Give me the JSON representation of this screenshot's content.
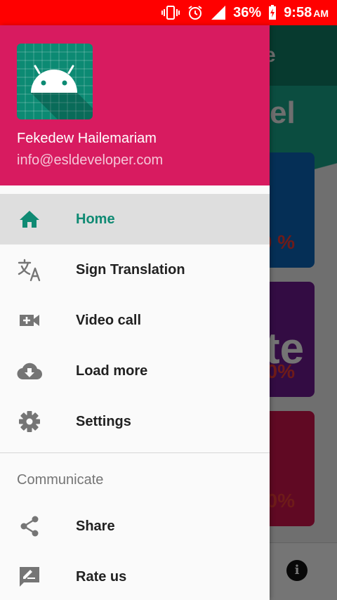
{
  "status_bar": {
    "battery": "36%",
    "time": "9:58",
    "ampm": "AM",
    "icons": [
      "vibrate-icon",
      "alarm-icon",
      "signal-icon",
      "battery-charging-icon"
    ]
  },
  "drawer": {
    "header": {
      "name": "Fekedew Hailemariam",
      "email": "info@esldeveloper.com",
      "avatar_icon": "android-icon"
    },
    "items": [
      {
        "label": "Home",
        "icon": "home-icon",
        "active": true
      },
      {
        "label": "Sign Translation",
        "icon": "translate-icon"
      },
      {
        "label": "Video call",
        "icon": "video-call-icon"
      },
      {
        "label": "Load more",
        "icon": "cloud-download-icon"
      },
      {
        "label": "Settings",
        "icon": "gear-icon"
      }
    ],
    "section_title": "Communicate",
    "section_items": [
      {
        "label": "Share",
        "icon": "share-icon"
      },
      {
        "label": "Rate us",
        "icon": "rate-icon"
      }
    ]
  },
  "background": {
    "appbar_text": "e",
    "hero_text": "el",
    "card_big_text": "te",
    "percent_1": "0 %",
    "percent_2": "0%",
    "percent_3": "0%",
    "info_icon": "info-icon"
  },
  "colors": {
    "status_bar": "#ff0000",
    "drawer_header": "#d81b60",
    "active_accent": "#0f8a73",
    "active_row": "#dedede"
  }
}
